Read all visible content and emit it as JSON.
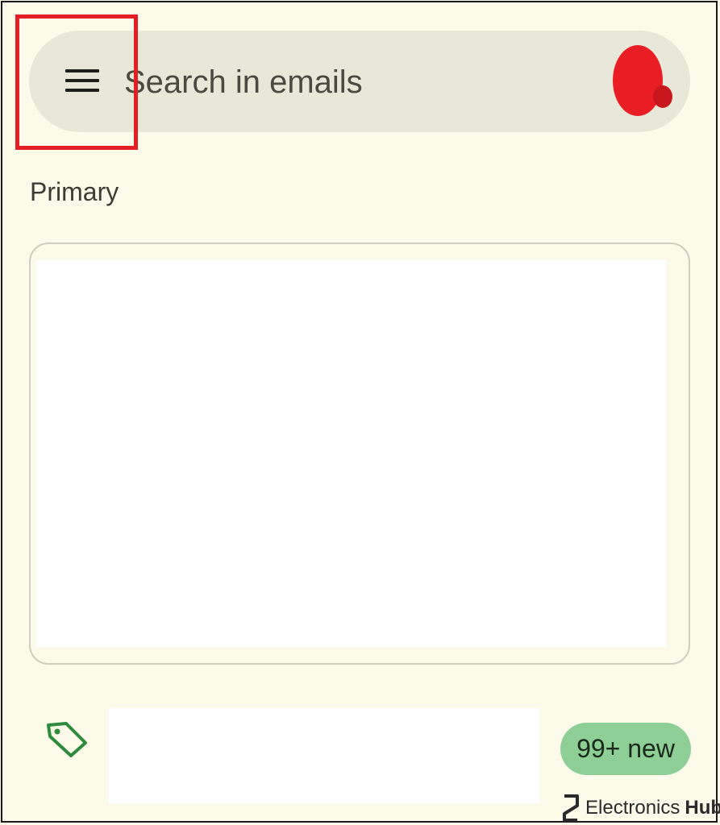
{
  "search": {
    "placeholder": "Search in emails"
  },
  "icons": {
    "menu": "hamburger-menu-icon",
    "account": "account-avatar",
    "tag": "tag-icon",
    "brand": "electronics-hub-logo-icon"
  },
  "colors": {
    "background": "#fcfbe9",
    "search_bar": "#e9e8d8",
    "highlight": "#e31e24",
    "badge": "#8ecf98",
    "tag_icon": "#2e8b3e"
  },
  "section": {
    "label": "Primary"
  },
  "category_row": {
    "badge": "99+ new"
  },
  "watermark": {
    "text_regular": "Electronics",
    "text_bold": "Hub"
  }
}
